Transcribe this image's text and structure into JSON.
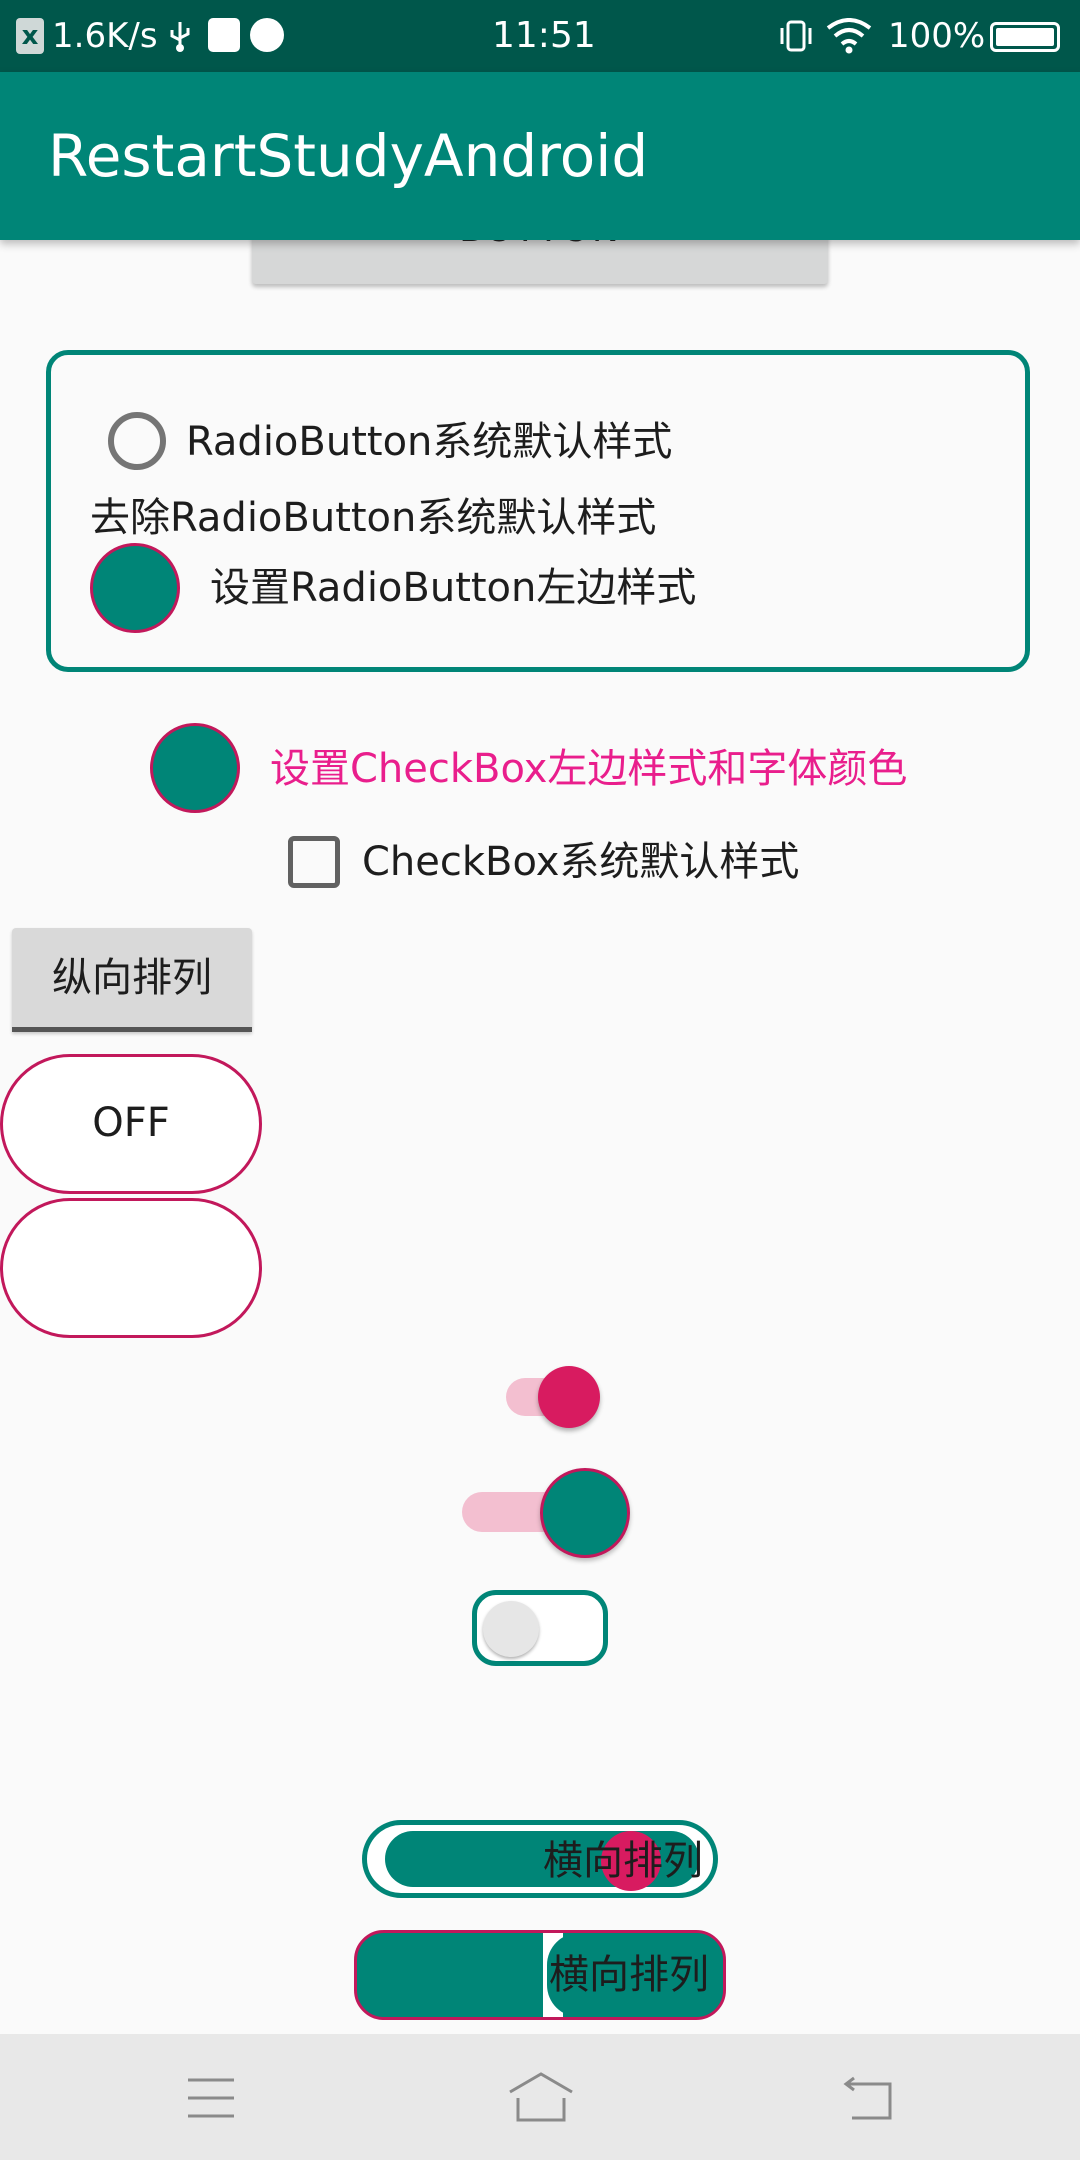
{
  "status_bar": {
    "speed": "1.6K/s",
    "time": "11:51",
    "battery": "100%",
    "icons": [
      "app-notification-icon",
      "usb-icon",
      "usb-debug-icon",
      "planet-app-icon",
      "vibrate-icon",
      "wifi-icon",
      "battery-icon"
    ]
  },
  "app_bar": {
    "title": "RestartStudyAndroid"
  },
  "top_button": {
    "label": "BUTTON"
  },
  "radio_group": {
    "default_label": "RadioButton系统默认样式",
    "removed_label": "去除RadioButton系统默认样式",
    "custom_label": "设置RadioButton左边样式"
  },
  "checkboxes": {
    "custom_label": "设置CheckBox左边样式和字体颜色",
    "default_label": "CheckBox系统默认样式"
  },
  "toggle_button": {
    "label": "纵向排列"
  },
  "pill_toggles": {
    "first_label": "OFF",
    "second_label": ""
  },
  "switches": {
    "first_checked": true,
    "second_checked": true,
    "third_checked": false
  },
  "horizontal_switches": {
    "first_label": "横向排列",
    "second_label": "横向排列"
  },
  "colors": {
    "primary": "#008577",
    "primary_dark": "#00574b",
    "accent": "#d81b60",
    "pink_text": "#e91e8c"
  },
  "nav_bar": {
    "icons": [
      "menu-icon",
      "home-icon",
      "back-icon"
    ]
  }
}
